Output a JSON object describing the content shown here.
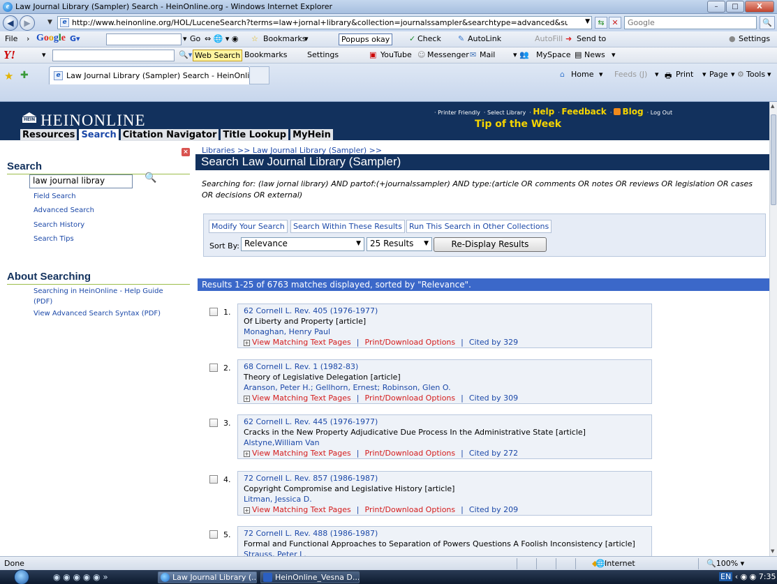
{
  "window": {
    "title": "Law Journal Library (Sampler) Search - HeinOnline.org - Windows Internet Explorer",
    "minimize": "–",
    "maximize": "□",
    "close": "X"
  },
  "address_bar": {
    "url": "http://www.heinonline.org/HOL/LuceneSearch?terms=law+jornal+library&collection=journalssampler&searchtype=advanced&submit=",
    "search_placeholder": "Google"
  },
  "google_toolbar": {
    "file_menu": "File",
    "go": "Go",
    "bookmarks": "Bookmarks",
    "popups": "Popups okay",
    "check": "Check",
    "autolink": "AutoLink",
    "autofill": "AutoFill",
    "send_to": "Send to",
    "settings": "Settings"
  },
  "yahoo_toolbar": {
    "web_search": "Web Search",
    "bookmarks": "Bookmarks",
    "settings": "Settings",
    "youtube": "YouTube",
    "messenger": "Messenger",
    "mail": "Mail",
    "myspace": "MySpace",
    "news": "News"
  },
  "tab": {
    "label": "Law Journal Library (Sampler) Search - HeinOnlin..."
  },
  "command_bar": {
    "home": "Home",
    "feeds": "Feeds (J)",
    "print": "Print",
    "page": "Page",
    "tools": "Tools"
  },
  "header": {
    "brand": "HEINONLINE",
    "logo_text": "HEIN",
    "printer_friendly": "Printer Friendly",
    "select_library": "Select Library",
    "help": "Help",
    "feedback": "Feedback",
    "blog": "Blog",
    "logout": "Log Out",
    "tip": "Tip of the Week",
    "tabs": [
      "Resources",
      "Search",
      "Citation Navigator",
      "Title Lookup",
      "MyHein"
    ]
  },
  "sidebar": {
    "search_heading": "Search",
    "search_value": "law journal libray",
    "links": [
      "Field Search",
      "Advanced Search",
      "Search History",
      "Search Tips"
    ],
    "about_heading": "About Searching",
    "about_links": [
      "Searching in HeinOnline - Help Guide (PDF)",
      "View Advanced Search Syntax (PDF)"
    ]
  },
  "main": {
    "breadcrumb": "Libraries >> Law Journal Library (Sampler) >>",
    "title": "Search Law Journal Library (Sampler)",
    "searching_for": "Searching for: (law jornal library) AND partof:(+journalssampler) AND type:(article OR comments OR notes OR reviews OR legislation OR cases OR decisions OR external)",
    "modify_buttons": [
      "Modify Your Search",
      "Search Within These Results",
      "Run This Search in Other Collections"
    ],
    "sort_by_label": "Sort By:",
    "sort_value": "Relevance",
    "results_per_page": "25 Results",
    "redisplay_button": "Re-Display Results",
    "results_summary": "Results 1-25 of 6763 matches displayed, sorted by \"Relevance\"."
  },
  "results": [
    {
      "num": "1.",
      "cite": "62 Cornell L. Rev. 405 (1976-1977)",
      "title": "Of Liberty and Property [article]",
      "author": "Monaghan, Henry Paul",
      "view": "View Matching Text Pages",
      "print": "Print/Download Options",
      "cited": "Cited by 329"
    },
    {
      "num": "2.",
      "cite": "68 Cornell L. Rev. 1 (1982-83)",
      "title": "Theory of Legislative Delegation [article]",
      "author": "Aranson, Peter H.; Gellhorn, Ernest; Robinson, Glen O.",
      "view": "View Matching Text Pages",
      "print": "Print/Download Options",
      "cited": "Cited by 309"
    },
    {
      "num": "3.",
      "cite": "62 Cornell L. Rev. 445 (1976-1977)",
      "title": "Cracks in the New Property Adjudicative Due Process In the Administrative State [article]",
      "author": "Alstyne,William Van",
      "view": "View Matching Text Pages",
      "print": "Print/Download Options",
      "cited": "Cited by 272"
    },
    {
      "num": "4.",
      "cite": "72 Cornell L. Rev. 857 (1986-1987)",
      "title": "Copyright Compromise and Legislative History [article]",
      "author": "Litman, Jessica D.",
      "view": "View Matching Text Pages",
      "print": "Print/Download Options",
      "cited": "Cited by 209"
    },
    {
      "num": "5.",
      "cite": "72 Cornell L. Rev. 488 (1986-1987)",
      "title": "Formal and Functional Approaches to Separation of Powers Questions A Foolish Inconsistency [article]",
      "author": "Strauss, Peter L.",
      "view": "",
      "print": "",
      "cited": ""
    }
  ],
  "status_bar": {
    "status": "Done",
    "zone": "Internet",
    "zoom": "100%"
  },
  "taskbar": {
    "tasks": [
      "Law Journal Library (...",
      "HeinOnline_Vesna D..."
    ],
    "lang": "EN",
    "time": "7:35"
  }
}
